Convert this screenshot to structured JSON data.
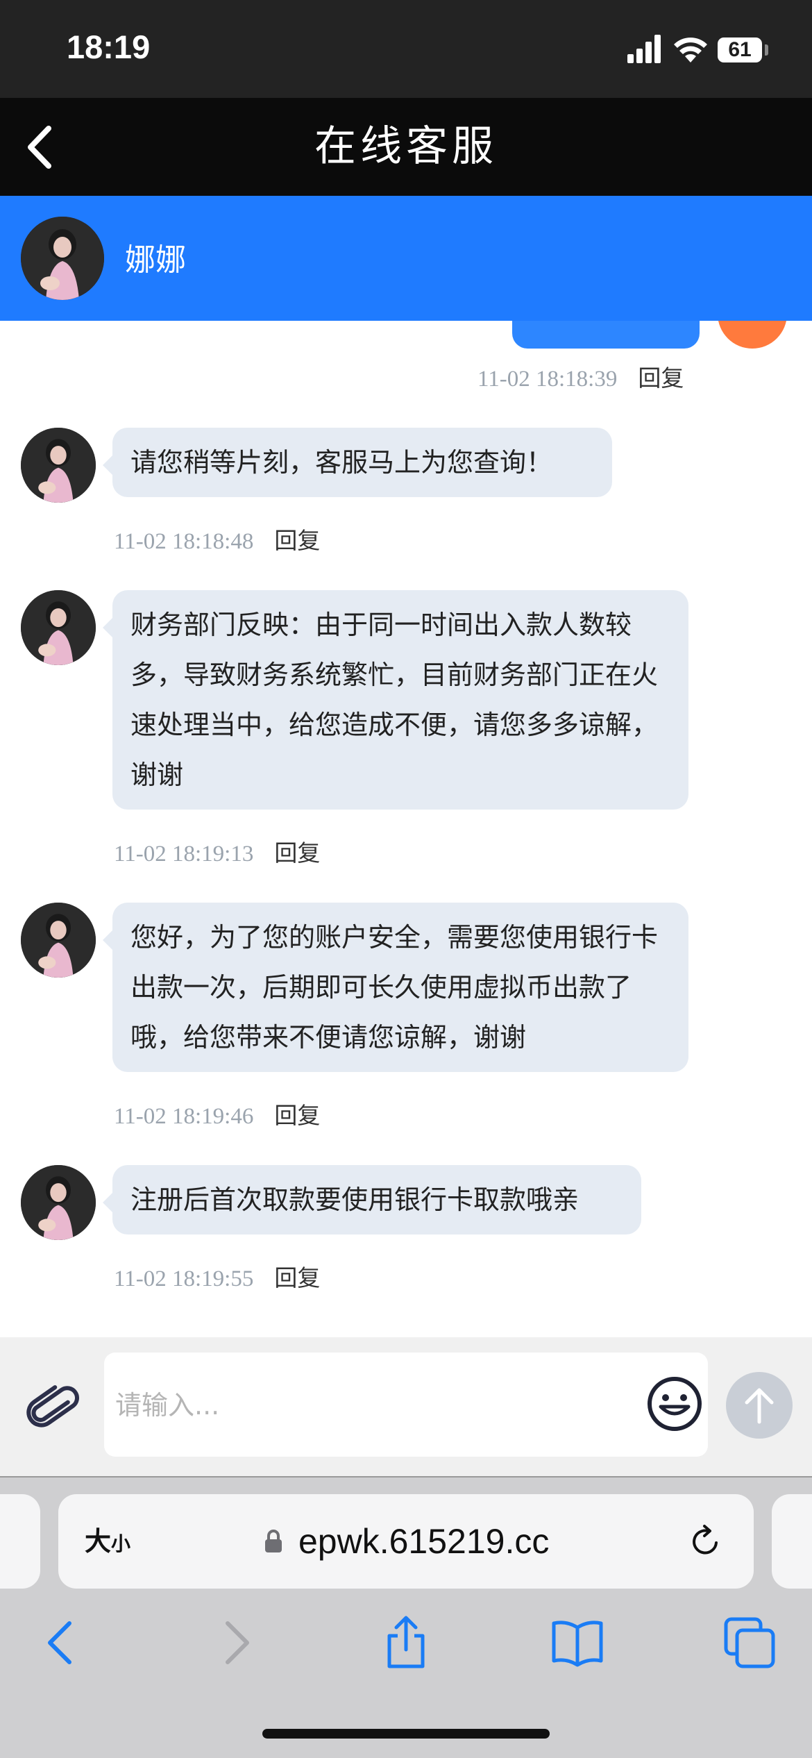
{
  "status_bar": {
    "time": "18:19",
    "battery": "61"
  },
  "nav": {
    "title": "在线客服"
  },
  "agent": {
    "name": "娜娜"
  },
  "messages": [
    {
      "text": "",
      "time": "11-02 18:18:39",
      "reply": "回复",
      "from": "user"
    },
    {
      "text": "请您稍等片刻，客服马上为您查询！",
      "time": "11-02 18:18:48",
      "reply": "回复",
      "from": "agent"
    },
    {
      "text": "财务部门反映：由于同一时间出入款人数较多，导致财务系统繁忙，目前财务部门正在火速处理当中，给您造成不便，请您多多谅解，谢谢",
      "time": "11-02 18:19:13",
      "reply": "回复",
      "from": "agent"
    },
    {
      "text": "您好，为了您的账户安全，需要您使用银行卡出款一次，后期即可长久使用虚拟币出款了哦，给您带来不便请您谅解，谢谢",
      "time": "11-02 18:19:46",
      "reply": "回复",
      "from": "agent"
    },
    {
      "text": "注册后首次取款要使用银行卡取款哦亲",
      "time": "11-02 18:19:55",
      "reply": "回复",
      "from": "agent"
    }
  ],
  "input": {
    "placeholder": "请输入..."
  },
  "browser": {
    "text_size_label": "大",
    "text_size_label_small": "小",
    "url": "epwk.615219.cc"
  },
  "colors": {
    "agent_bar": "#1f7bff",
    "bubble": "#e5ebf3",
    "nav_bg": "#0b0b0b"
  },
  "icons": {
    "attach": "paperclip-icon",
    "emoji": "smile-icon",
    "send": "arrow-up-icon",
    "lock": "lock-icon",
    "reload": "reload-icon"
  }
}
